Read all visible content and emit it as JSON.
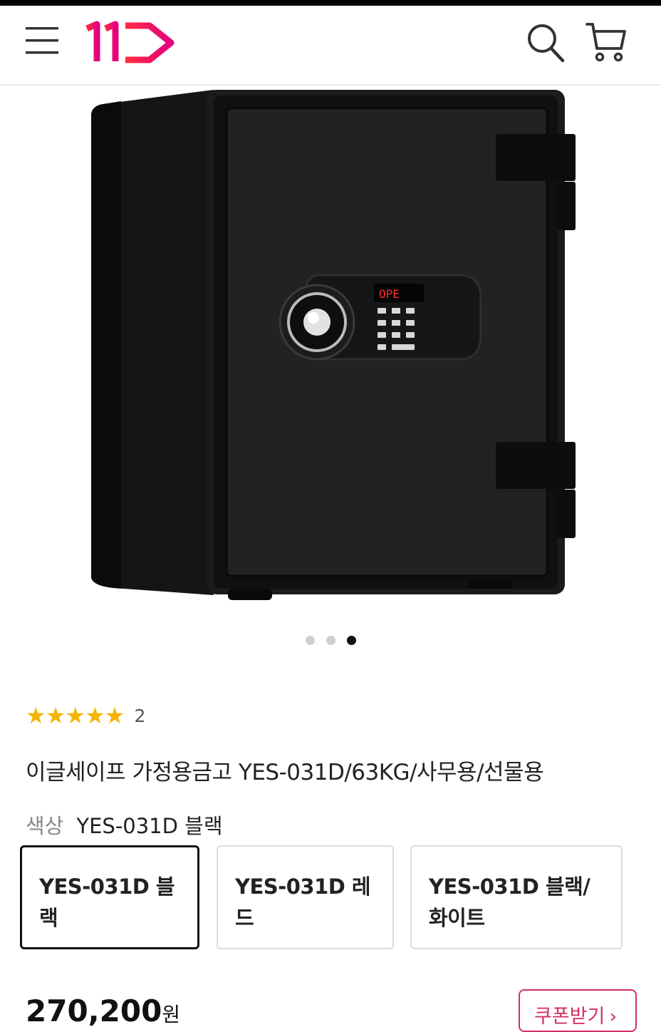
{
  "header": {
    "icons": [
      "menu-icon",
      "11st-logo",
      "search-icon",
      "cart-icon"
    ],
    "brand_color": "#f2105a"
  },
  "gallery": {
    "slide_count": 3,
    "active_slide": 3,
    "display_text": "OPE"
  },
  "rating": {
    "stars": "★★★★★",
    "count": "2",
    "star_color": "#f4b400"
  },
  "product": {
    "title": "이글세이프 가정용금고 YES-031D/63KG/사무용/선물용"
  },
  "options": {
    "label": "색상",
    "selected_value": "YES-031D 블랙",
    "choices": [
      "YES-031D 블랙",
      "YES-031D 레드",
      "YES-031D 블랙/화이트"
    ]
  },
  "price": {
    "amount": "270,200",
    "unit": "원"
  },
  "coupon": {
    "label": "쿠폰받기",
    "chevron": "›",
    "color": "#d32f5f"
  }
}
